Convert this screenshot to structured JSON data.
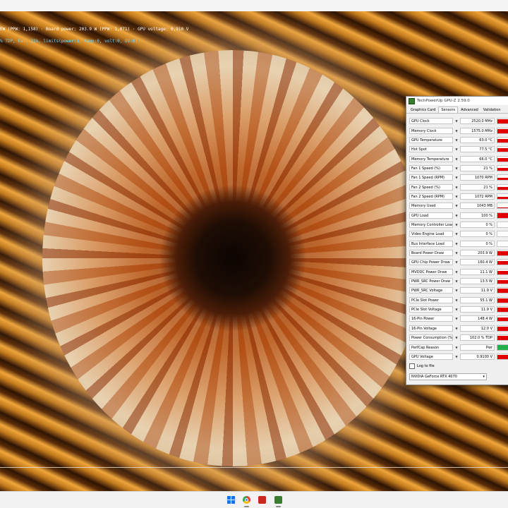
{
  "overlay": {
    "line1": "EW (PPW: 1,158) · Board power: 203.9 W (PPW: 1,071) · GPU voltage: 0,910 V",
    "line2": "% TDP, Fan: 21%, limits(power:1, temp:0, volt:0, OV:0)"
  },
  "gpuz": {
    "title": "TechPowerUp GPU-Z 2.59.0",
    "tabs": [
      "Graphics Card",
      "Sensors",
      "Advanced",
      "Validation"
    ],
    "active_tab": "Sensors",
    "sensors": [
      {
        "name": "GPU Clock",
        "value": "2520.0 MHz",
        "level": 0.85,
        "color": "#e00000"
      },
      {
        "name": "Memory Clock",
        "value": "1575.0 MHz",
        "level": 0.85,
        "color": "#e00000"
      },
      {
        "name": "GPU Temperature",
        "value": "63.0 °C",
        "level": 0.7,
        "color": "#e00000"
      },
      {
        "name": "Hot Spot",
        "value": "77.5 °C",
        "level": 0.7,
        "color": "#e00000"
      },
      {
        "name": "Memory Temperature",
        "value": "66.0 °C",
        "level": 0.7,
        "color": "#e00000"
      },
      {
        "name": "Fan 1 Speed (%)",
        "value": "21 %",
        "level": 0.5,
        "color": "#e00000"
      },
      {
        "name": "Fan 1 Speed (RPM)",
        "value": "1070 RPM",
        "level": 0.5,
        "color": "#e00000"
      },
      {
        "name": "Fan 2 Speed (%)",
        "value": "21 %",
        "level": 0.5,
        "color": "#e00000"
      },
      {
        "name": "Fan 2 Speed (RPM)",
        "value": "1072 RPM",
        "level": 0.5,
        "color": "#e00000"
      },
      {
        "name": "Memory Used",
        "value": "1043 MB",
        "level": 0.15,
        "color": "#e00000"
      },
      {
        "name": "GPU Load",
        "value": "100 %",
        "level": 0.9,
        "color": "#e00000"
      },
      {
        "name": "Memory Controller Load",
        "value": "0 %",
        "level": 0.0,
        "color": "#e00000"
      },
      {
        "name": "Video Engine Load",
        "value": "0 %",
        "level": 0.0,
        "color": "#e00000"
      },
      {
        "name": "Bus Interface Load",
        "value": "0 %",
        "level": 0.0,
        "color": "#e00000"
      },
      {
        "name": "Board Power Draw",
        "value": "203.9 W",
        "level": 0.8,
        "color": "#e00000"
      },
      {
        "name": "GPU Chip Power Draw",
        "value": "160.4 W",
        "level": 0.75,
        "color": "#e00000"
      },
      {
        "name": "MVDDC Power Draw",
        "value": "11.1 W",
        "level": 0.75,
        "color": "#e00000"
      },
      {
        "name": "PWR_SRC Power Draw",
        "value": "13.5 W",
        "level": 0.75,
        "color": "#e00000"
      },
      {
        "name": "PWR_SRC Voltage",
        "value": "11.9 V",
        "level": 0.9,
        "color": "#e00000"
      },
      {
        "name": "PCIe Slot Power",
        "value": "55.1 W",
        "level": 0.8,
        "color": "#e00000"
      },
      {
        "name": "PCIe Slot Voltage",
        "value": "11.9 V",
        "level": 0.9,
        "color": "#e00000"
      },
      {
        "name": "16-Pin Power",
        "value": "148.4 W",
        "level": 0.8,
        "color": "#e00000"
      },
      {
        "name": "16-Pin Voltage",
        "value": "12.0 V",
        "level": 0.9,
        "color": "#e00000"
      },
      {
        "name": "Power Consumption (%)",
        "value": "102.0 % TDP",
        "level": 0.85,
        "color": "#e00000"
      },
      {
        "name": "PerfCap Reason",
        "value": "Pwr",
        "level": 1.0,
        "color": "#22b14c"
      },
      {
        "name": "GPU Voltage",
        "value": "0.9100 V",
        "level": 0.8,
        "color": "#e00000"
      }
    ],
    "log_label": "Log to file",
    "gpu_name": "NVIDIA GeForce RTX 4070"
  },
  "taskbar": {
    "icons": [
      "windows-start-icon",
      "chrome-icon",
      "red-app-icon",
      "gpuz-icon"
    ]
  }
}
